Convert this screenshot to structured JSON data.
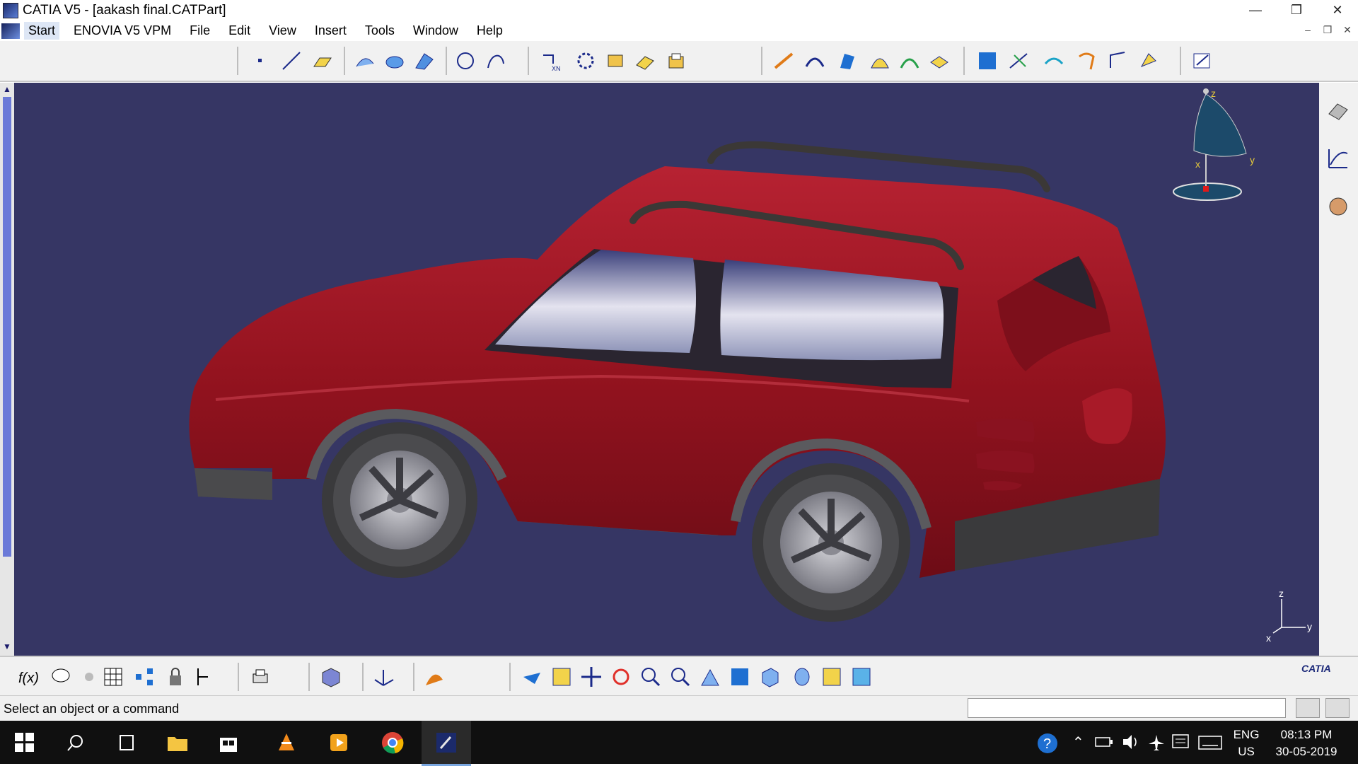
{
  "window": {
    "title": "CATIA V5 - [aakash final.CATPart]"
  },
  "menu": {
    "start": "Start",
    "items": [
      "ENOVIA V5 VPM",
      "File",
      "Edit",
      "View",
      "Insert",
      "Tools",
      "Window",
      "Help"
    ]
  },
  "status": {
    "message": "Select an object or a command"
  },
  "compass": {
    "x": "x",
    "y": "y",
    "z": "z"
  },
  "axis": {
    "x": "x",
    "y": "y",
    "z": "z"
  },
  "brand": {
    "logo": "CATIA"
  },
  "colors": {
    "viewport_bg": "#363664",
    "car_body": "#9b1623",
    "accent": "#6b7ad8"
  },
  "taskbar": {
    "apps": [
      "windows-start",
      "search",
      "task-view",
      "file-explorer",
      "microsoft-store",
      "vlc",
      "media-player",
      "chrome",
      "catia"
    ],
    "lang_top": "ENG",
    "lang_bottom": "US",
    "time": "08:13 PM",
    "date": "30-05-2019"
  }
}
